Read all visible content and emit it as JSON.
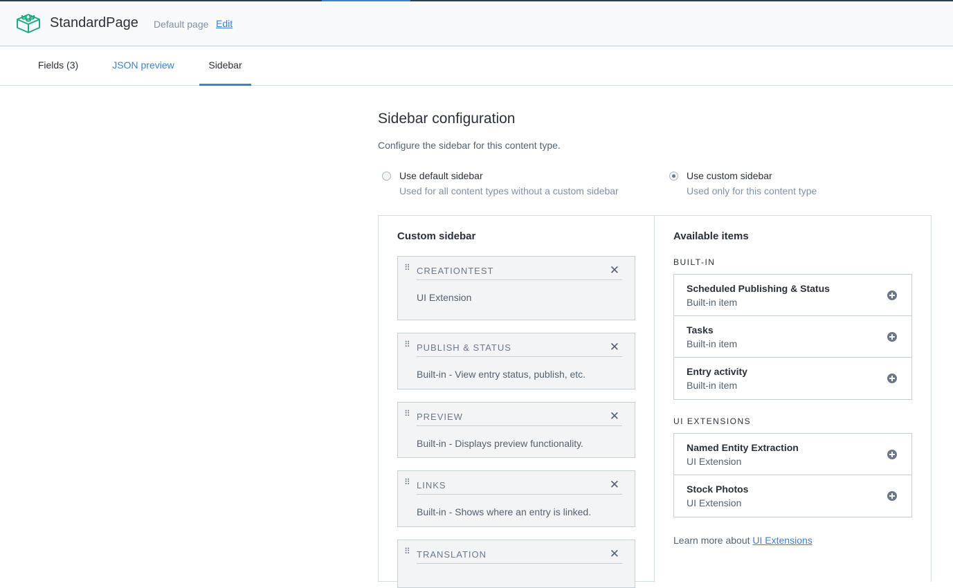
{
  "header": {
    "title": "StandardPage",
    "subtitle": "Default page",
    "edit_label": "Edit",
    "logo_icon": "content-type-cube-icon",
    "accent_color": "#3c80cf"
  },
  "tabs": [
    {
      "label": "Fields (3)"
    },
    {
      "label": "JSON preview"
    },
    {
      "label": "Sidebar",
      "active": true
    }
  ],
  "config": {
    "title": "Sidebar configuration",
    "description": "Configure the sidebar for this content type.",
    "options": [
      {
        "label": "Use default sidebar",
        "sub": "Used for all content types without a custom sidebar",
        "selected": false
      },
      {
        "label": "Use custom sidebar",
        "sub": "Used only for this content type",
        "selected": true
      }
    ]
  },
  "custom_sidebar": {
    "title": "Custom sidebar",
    "items": [
      {
        "name": "CREATIONTEST",
        "desc": "UI Extension"
      },
      {
        "name": "PUBLISH & STATUS",
        "desc": "Built-in - View entry status, publish, etc."
      },
      {
        "name": "PREVIEW",
        "desc": "Built-in - Displays preview functionality."
      },
      {
        "name": "LINKS",
        "desc": "Built-in - Shows where an entry is linked."
      },
      {
        "name": "TRANSLATION",
        "desc": ""
      }
    ]
  },
  "available": {
    "title": "Available items",
    "builtin_label": "BUILT-IN",
    "builtin": [
      {
        "name": "Scheduled Publishing & Status",
        "type": "Built-in item"
      },
      {
        "name": "Tasks",
        "type": "Built-in item"
      },
      {
        "name": "Entry activity",
        "type": "Built-in item"
      }
    ],
    "extensions_label": "UI EXTENSIONS",
    "extensions": [
      {
        "name": "Named Entity Extraction",
        "type": "UI Extension"
      },
      {
        "name": "Stock Photos",
        "type": "UI Extension"
      }
    ],
    "learn_prefix": "Learn more about ",
    "learn_link": "UI Extensions"
  }
}
